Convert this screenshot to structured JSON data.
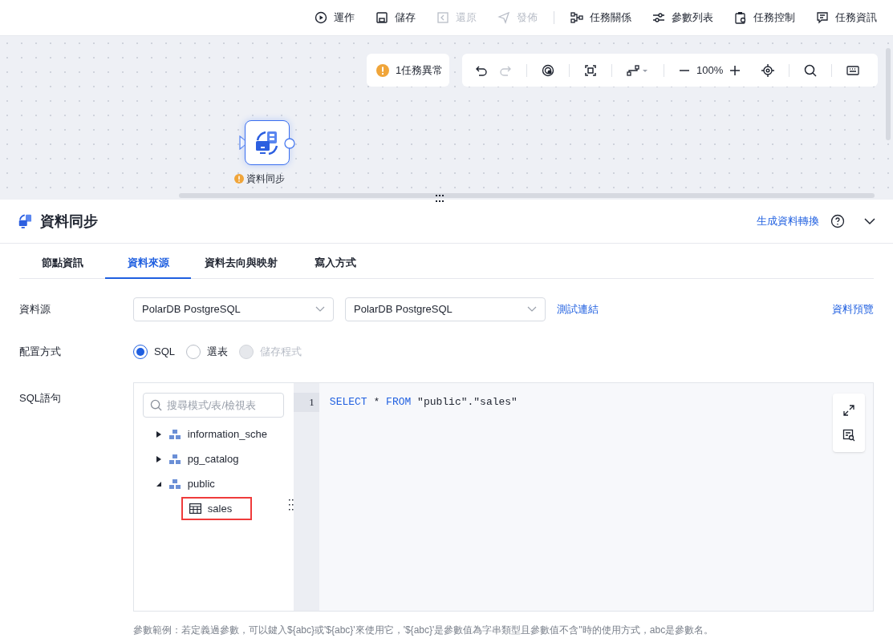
{
  "toolbar": {
    "items": [
      {
        "label": "運作",
        "disabled": false
      },
      {
        "label": "儲存",
        "disabled": false
      },
      {
        "label": "還原",
        "disabled": true
      },
      {
        "label": "發佈",
        "disabled": true
      },
      {
        "label": "任務關係",
        "disabled": false
      },
      {
        "label": "參數列表",
        "disabled": false
      },
      {
        "label": "任務控制",
        "disabled": false
      },
      {
        "label": "任務資訊",
        "disabled": false
      }
    ]
  },
  "canvas": {
    "warning_badge": "1任務異常",
    "zoom": "100%",
    "redo_disabled": true,
    "node": {
      "label": "資料同步",
      "warning": true
    }
  },
  "panel": {
    "title": "資料同步",
    "link": "生成資料轉換",
    "tabs": [
      {
        "label": "節點資訊",
        "selected": false
      },
      {
        "label": "資料來源",
        "selected": true
      },
      {
        "label": "資料去向與映射",
        "selected": false
      },
      {
        "label": "寫入方式",
        "selected": false
      }
    ],
    "datasource": {
      "label": "資料源",
      "selects": [
        "PolarDB PostgreSQL",
        "PolarDB PostgreSQL"
      ],
      "test_link": "測試連結",
      "preview_link": "資料預覽"
    },
    "config": {
      "label": "配置方式",
      "options": [
        {
          "label": "SQL",
          "selected": true,
          "disabled": false
        },
        {
          "label": "選表",
          "selected": false,
          "disabled": false
        },
        {
          "label": "儲存程式",
          "selected": false,
          "disabled": true
        }
      ]
    },
    "sql": {
      "label": "SQL語句",
      "search_placeholder": "搜尋模式/表/檢視表",
      "tree": [
        {
          "label": "information_sche",
          "expanded": false
        },
        {
          "label": "pg_catalog",
          "expanded": false
        },
        {
          "label": "public",
          "expanded": true,
          "children": [
            {
              "label": "sales",
              "highlighted": true
            }
          ]
        }
      ],
      "line_number": "1",
      "code": [
        {
          "kind": "keyword",
          "text": "SELECT"
        },
        {
          "kind": "plain",
          "text": " * "
        },
        {
          "kind": "keyword",
          "text": "FROM"
        },
        {
          "kind": "plain",
          "text": " \"public\".\"sales\""
        }
      ]
    },
    "hint": "參數範例：若定義過參數，可以鍵入${abc}或'${abc}'來使用它，'${abc}'是參數值為字串類型且參數值不含''時的使用方式，abc是參數名。"
  }
}
